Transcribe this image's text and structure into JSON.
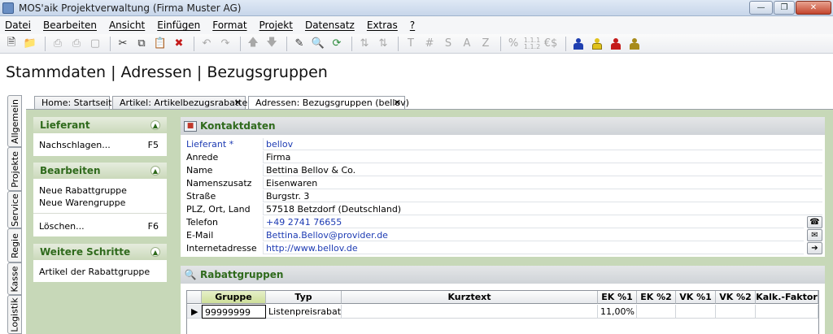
{
  "window": {
    "title": "MOS'aik Projektverwaltung (Firma Muster AG)"
  },
  "menu": [
    "Datei",
    "Bearbeiten",
    "Ansicht",
    "Einfügen",
    "Format",
    "Projekt",
    "Datensatz",
    "Extras",
    "?"
  ],
  "toolbar_text": {
    "t": "T",
    "hash": "#",
    "s": "S",
    "a": "A",
    "z": "Z",
    "pct": "%",
    "eur": "€$"
  },
  "page": {
    "title": "Stammdaten | Adressen | Bezugsgruppen"
  },
  "side_tabs": [
    "Allgemein",
    "Projekte",
    "Service",
    "Regie",
    "Kasse",
    "Logistik"
  ],
  "doc_tabs": [
    {
      "label": "Home: Startseite"
    },
    {
      "label": "Artikel: Artikelbezugsrabatte",
      "close": "✕"
    },
    {
      "label": "Adressen: Bezugsgruppen (bellov)",
      "close": "✕"
    }
  ],
  "left": {
    "lieferant": {
      "title": "Lieferant",
      "items": [
        {
          "label": "Nachschlagen...",
          "key": "F5"
        }
      ]
    },
    "bearbeiten": {
      "title": "Bearbeiten",
      "items": [
        {
          "label": "Neue Rabattgruppe"
        },
        {
          "label": "Neue Warengruppe"
        },
        {
          "label": "Löschen...",
          "key": "F6"
        }
      ]
    },
    "weitere": {
      "title": "Weitere Schritte",
      "items": [
        {
          "label": "Artikel der Rabattgruppe"
        }
      ]
    }
  },
  "kontakt": {
    "title": "Kontaktdaten",
    "fields": [
      {
        "label": "Lieferant *",
        "value": "bellov"
      },
      {
        "label": "Anrede",
        "value": "Firma"
      },
      {
        "label": "Name",
        "value": "Bettina Bellov & Co."
      },
      {
        "label": "Namenszusatz",
        "value": "Eisenwaren"
      },
      {
        "label": "Straße",
        "value": "Burgstr. 3"
      },
      {
        "label": "PLZ, Ort, Land",
        "value": "57518 Betzdorf (Deutschland)"
      },
      {
        "label": "Telefon",
        "value": "+49 2741 76655"
      },
      {
        "label": "E-Mail",
        "value": "Bettina.Bellov@provider.de"
      },
      {
        "label": "Internetadresse",
        "value": "http://www.bellov.de"
      }
    ]
  },
  "rabatt": {
    "title": "Rabattgruppen",
    "columns": [
      "Gruppe",
      "Typ",
      "Kurztext",
      "EK %1",
      "EK %2",
      "VK %1",
      "VK %2",
      "Kalk.-Faktor"
    ],
    "rows": [
      [
        "99999999",
        "Listenpreisrabatt",
        "",
        "11,00%",
        "",
        "",
        "",
        ""
      ]
    ]
  },
  "colors": {
    "accent": "#2f6a1c",
    "content_bg": "#c7d8b8",
    "link": "#1d3bb3"
  }
}
